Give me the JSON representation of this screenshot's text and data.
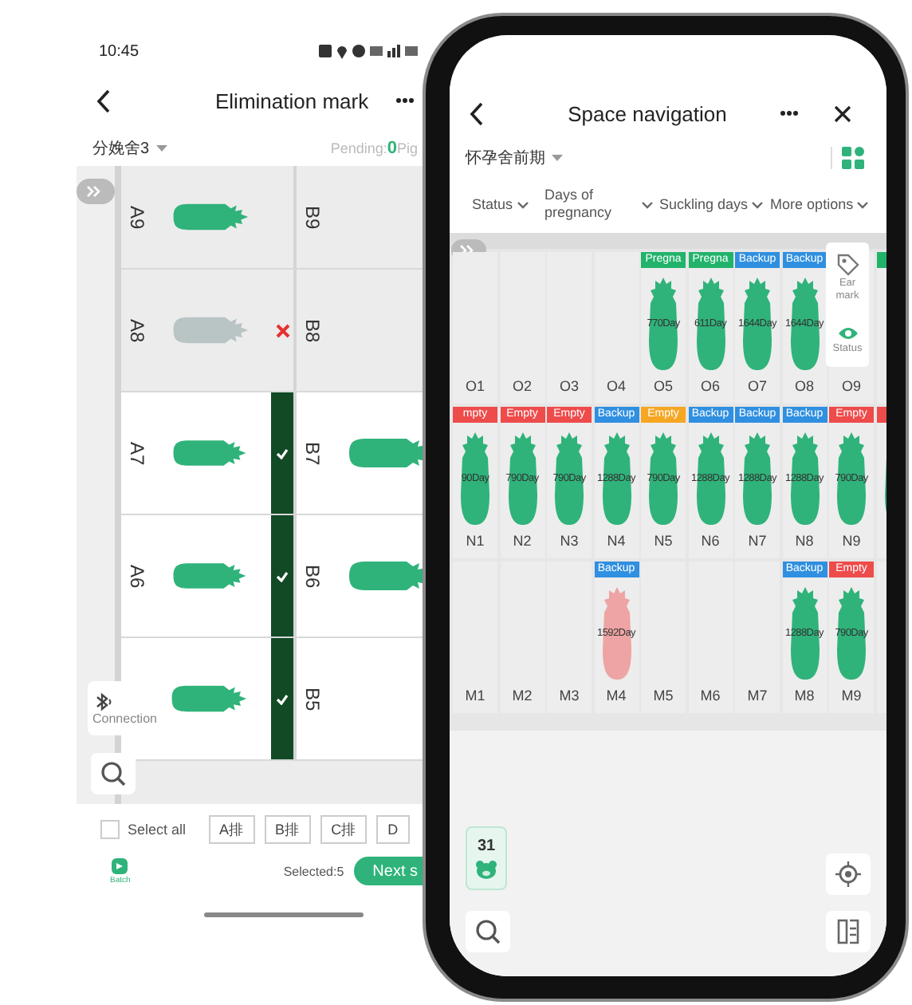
{
  "left_screen": {
    "status_bar": {
      "time": "10:45"
    },
    "title": "Elimination mark",
    "house": "分娩舍3",
    "pending_label": "Pending:",
    "pending_count": "0",
    "pending_unit": "Pig",
    "rows": [
      {
        "selected": false,
        "a": {
          "label": "A9",
          "pig": {
            "kind": "normal"
          }
        },
        "b": {
          "label": "B9"
        }
      },
      {
        "selected": false,
        "a": {
          "label": "A8",
          "pig": {
            "kind": "eliminated"
          }
        },
        "b": {
          "label": "B8"
        }
      },
      {
        "selected": true,
        "a": {
          "label": "A7",
          "pig": {
            "kind": "normal"
          }
        },
        "b": {
          "label": "B7",
          "pig": {
            "kind": "normal"
          }
        }
      },
      {
        "selected": true,
        "a": {
          "label": "A6",
          "pig": {
            "kind": "normal"
          }
        },
        "b": {
          "label": "B6",
          "pig": {
            "kind": "normal"
          }
        }
      },
      {
        "selected": true,
        "a": {
          "pig": {
            "kind": "normal"
          }
        },
        "b": {
          "label": "B5"
        }
      }
    ],
    "connection": "Connection",
    "select_all": {
      "label": "Select all",
      "checked": false
    },
    "row_buttons": [
      "A排",
      "B排",
      "C排",
      "D"
    ],
    "batch": "Batch",
    "selected_count": "Selected:5",
    "next_button": "Next s"
  },
  "right_screen": {
    "title": "Space navigation",
    "house": "怀孕舍前期",
    "filters": [
      "Status",
      "Days of pregnancy",
      "Suckling days",
      "More options"
    ],
    "side_panel": [
      "Ear mark",
      "Status"
    ],
    "rows": [
      {
        "cells": [
          {
            "label": "O1"
          },
          {
            "label": "O2"
          },
          {
            "label": "O3"
          },
          {
            "label": "O4"
          },
          {
            "label": "O5",
            "tag": {
              "text": "Pregna",
              "color": "#22b36b"
            },
            "pig": {
              "kind": "normal"
            },
            "days": "770Day"
          },
          {
            "label": "O6",
            "tag": {
              "text": "Pregna",
              "color": "#22b36b"
            },
            "pig": {
              "kind": "normal"
            },
            "days": "611Day"
          },
          {
            "label": "O7",
            "tag": {
              "text": "Backup",
              "color": "#2f8fe0"
            },
            "pig": {
              "kind": "normal"
            },
            "days": "1644Day"
          },
          {
            "label": "O8",
            "tag": {
              "text": "Backup",
              "color": "#2f8fe0"
            },
            "pig": {
              "kind": "normal"
            },
            "days": "1644Day"
          },
          {
            "label": "O9"
          },
          {
            "tag": {
              "color": "#22b36b"
            }
          }
        ]
      },
      {
        "cells": [
          {
            "label": "N1",
            "tag": {
              "text": "mpty",
              "color": "#ee4b4b"
            },
            "pig": {
              "kind": "normal"
            },
            "days": "90Day"
          },
          {
            "label": "N2",
            "tag": {
              "text": "Empty",
              "color": "#ee4b4b"
            },
            "pig": {
              "kind": "normal"
            },
            "days": "790Day"
          },
          {
            "label": "N3",
            "tag": {
              "text": "Empty",
              "color": "#ee4b4b"
            },
            "pig": {
              "kind": "normal"
            },
            "days": "790Day"
          },
          {
            "label": "N4",
            "tag": {
              "text": "Backup",
              "color": "#2f8fe0"
            },
            "pig": {
              "kind": "normal"
            },
            "days": "1288Day"
          },
          {
            "label": "N5",
            "tag": {
              "text": "Empty",
              "color": "#f5a623"
            },
            "pig": {
              "kind": "normal"
            },
            "days": "790Day"
          },
          {
            "label": "N6",
            "tag": {
              "text": "Backup",
              "color": "#2f8fe0"
            },
            "pig": {
              "kind": "normal"
            },
            "days": "1288Day"
          },
          {
            "label": "N7",
            "tag": {
              "text": "Backup",
              "color": "#2f8fe0"
            },
            "pig": {
              "kind": "normal"
            },
            "days": "1288Day"
          },
          {
            "label": "N8",
            "tag": {
              "text": "Backup",
              "color": "#2f8fe0"
            },
            "pig": {
              "kind": "normal"
            },
            "days": "1288Day"
          },
          {
            "label": "N9",
            "tag": {
              "text": "Empty",
              "color": "#ee4b4b"
            },
            "pig": {
              "kind": "normal"
            },
            "days": "790Day"
          },
          {
            "tag": {
              "color": "#ee4b4b"
            },
            "pig": {
              "kind": "normal"
            }
          }
        ]
      },
      {
        "cells": [
          {
            "label": "M1"
          },
          {
            "label": "M2"
          },
          {
            "label": "M3"
          },
          {
            "label": "M4",
            "tag": {
              "text": "Backup",
              "color": "#2f8fe0"
            },
            "pig": {
              "kind": "alert"
            },
            "days": "1592Day"
          },
          {
            "label": "M5"
          },
          {
            "label": "M6"
          },
          {
            "label": "M7"
          },
          {
            "label": "M8",
            "tag": {
              "text": "Backup",
              "color": "#2f8fe0"
            },
            "pig": {
              "kind": "normal"
            },
            "days": "1288Day"
          },
          {
            "label": "M9",
            "tag": {
              "text": "Empty",
              "color": "#ee4b4b"
            },
            "pig": {
              "kind": "normal"
            },
            "days": "790Day"
          },
          {}
        ]
      }
    ],
    "pig_count": "31"
  }
}
